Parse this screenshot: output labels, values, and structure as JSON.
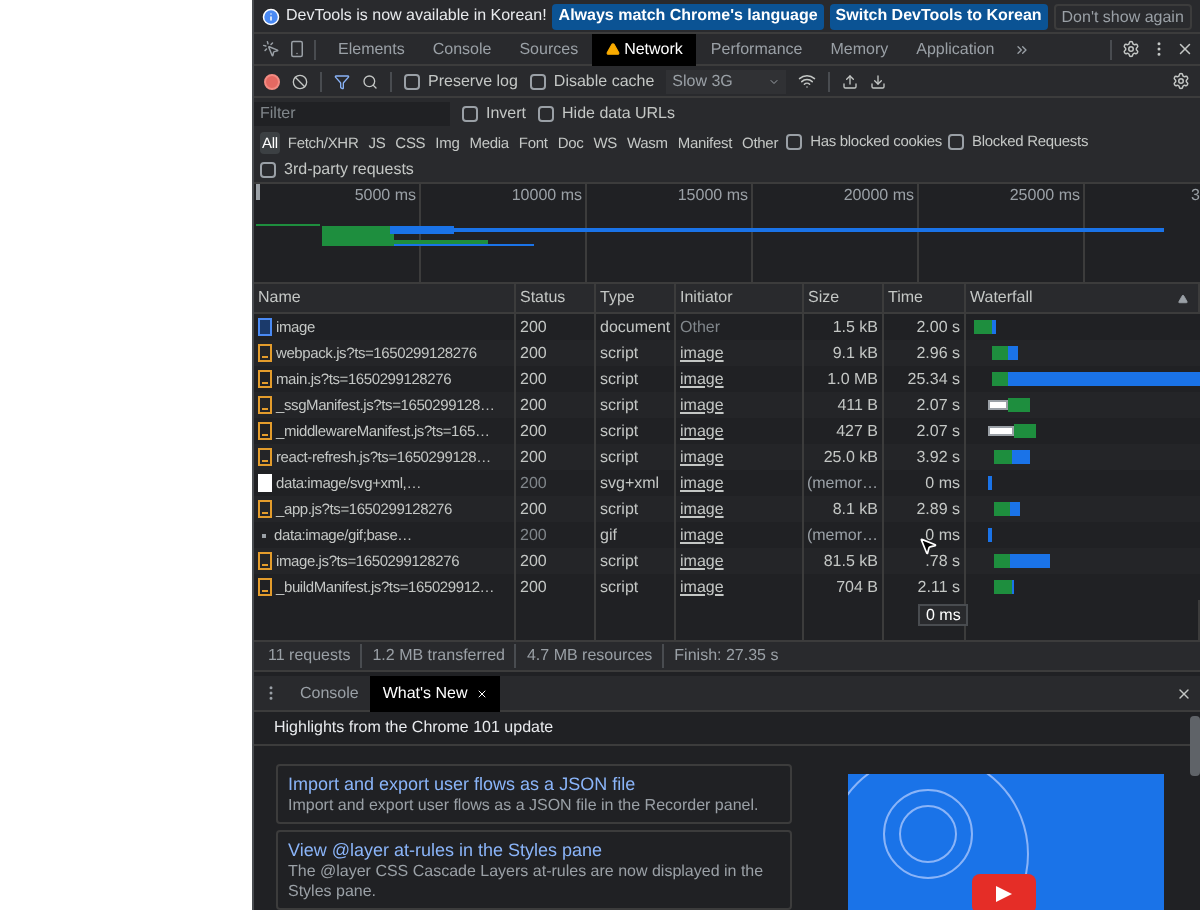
{
  "infobar": {
    "message": "DevTools is now available in Korean!",
    "buttons": [
      {
        "label": "Always match Chrome's language",
        "kind": "primary"
      },
      {
        "label": "Switch DevTools to Korean",
        "kind": "primary"
      },
      {
        "label": "Don't show again",
        "kind": "plain"
      }
    ]
  },
  "tabs": [
    {
      "label": "Elements",
      "selected": false,
      "warning": false
    },
    {
      "label": "Console",
      "selected": false,
      "warning": false
    },
    {
      "label": "Sources",
      "selected": false,
      "warning": false
    },
    {
      "label": "Network",
      "selected": true,
      "warning": true
    },
    {
      "label": "Performance",
      "selected": false,
      "warning": false
    },
    {
      "label": "Memory",
      "selected": false,
      "warning": false
    },
    {
      "label": "Application",
      "selected": false,
      "warning": false
    }
  ],
  "toolbar": {
    "options": [
      {
        "label": "Preserve log",
        "checked": false
      },
      {
        "label": "Disable cache",
        "checked": false
      }
    ],
    "throttling": "Slow 3G"
  },
  "filter": {
    "placeholder": "Filter",
    "options": [
      {
        "label": "Invert",
        "checked": false
      },
      {
        "label": "Hide data URLs",
        "checked": false
      }
    ]
  },
  "type_filters": [
    {
      "label": "All",
      "selected": true
    },
    {
      "label": "Fetch/XHR",
      "selected": false
    },
    {
      "label": "JS",
      "selected": false
    },
    {
      "label": "CSS",
      "selected": false
    },
    {
      "label": "Img",
      "selected": false
    },
    {
      "label": "Media",
      "selected": false
    },
    {
      "label": "Font",
      "selected": false
    },
    {
      "label": "Doc",
      "selected": false
    },
    {
      "label": "WS",
      "selected": false
    },
    {
      "label": "Wasm",
      "selected": false
    },
    {
      "label": "Manifest",
      "selected": false
    },
    {
      "label": "Other",
      "selected": false
    }
  ],
  "type_options": [
    {
      "label": "Has blocked cookies",
      "checked": false
    },
    {
      "label": "Blocked Requests",
      "checked": false
    }
  ],
  "third_party": {
    "label": "3rd-party requests",
    "checked": false
  },
  "overview": {
    "ticks": [
      "5000 ms",
      "10000 ms",
      "15000 ms",
      "20000 ms",
      "25000 ms",
      "3"
    ]
  },
  "table": {
    "columns": [
      {
        "label": "Name",
        "sorted": false
      },
      {
        "label": "Status",
        "sorted": false
      },
      {
        "label": "Type",
        "sorted": false
      },
      {
        "label": "Initiator",
        "sorted": false
      },
      {
        "label": "Size",
        "sorted": false
      },
      {
        "label": "Time",
        "sorted": false
      },
      {
        "label": "Waterfall",
        "sorted": true
      }
    ],
    "rows": [
      {
        "name": "image",
        "kind": "document",
        "status": "200",
        "cached": false,
        "type": "document",
        "initiator": "Other",
        "initiator_link": false,
        "size": "1.5 kB",
        "time": "2.00 s"
      },
      {
        "name": "webpack.js?ts=1650299128276",
        "kind": "script",
        "status": "200",
        "cached": false,
        "type": "script",
        "initiator": "image",
        "initiator_link": true,
        "size": "9.1 kB",
        "time": "2.96 s"
      },
      {
        "name": "main.js?ts=1650299128276",
        "kind": "script",
        "status": "200",
        "cached": false,
        "type": "script",
        "initiator": "image",
        "initiator_link": true,
        "size": "1.0 MB",
        "time": "25.34 s"
      },
      {
        "name": "_ssgManifest.js?ts=1650299128…",
        "kind": "script",
        "status": "200",
        "cached": false,
        "type": "script",
        "initiator": "image",
        "initiator_link": true,
        "size": "411 B",
        "time": "2.07 s"
      },
      {
        "name": "_middlewareManifest.js?ts=165…",
        "kind": "script",
        "status": "200",
        "cached": false,
        "type": "script",
        "initiator": "image",
        "initiator_link": true,
        "size": "427 B",
        "time": "2.07 s"
      },
      {
        "name": "react-refresh.js?ts=1650299128…",
        "kind": "script",
        "status": "200",
        "cached": false,
        "type": "script",
        "initiator": "image",
        "initiator_link": true,
        "size": "25.0 kB",
        "time": "3.92 s"
      },
      {
        "name": "data:image/svg+xml,…",
        "kind": "svg",
        "status": "200",
        "cached": true,
        "type": "svg+xml",
        "initiator": "image",
        "initiator_link": true,
        "size": "(memor…",
        "time": "0 ms"
      },
      {
        "name": "_app.js?ts=1650299128276",
        "kind": "script",
        "status": "200",
        "cached": false,
        "type": "script",
        "initiator": "image",
        "initiator_link": true,
        "size": "8.1 kB",
        "time": "2.89 s"
      },
      {
        "name": "data:image/gif;base…",
        "kind": "gif",
        "status": "200",
        "cached": true,
        "type": "gif",
        "initiator": "image",
        "initiator_link": true,
        "size": "(memor…",
        "time": "0 ms"
      },
      {
        "name": "image.js?ts=1650299128276",
        "kind": "script",
        "status": "200",
        "cached": false,
        "type": "script",
        "initiator": "image",
        "initiator_link": true,
        "size": "81.5 kB",
        "time": ".78 s"
      },
      {
        "name": "_buildManifest.js?ts=165029912…",
        "kind": "script",
        "status": "200",
        "cached": false,
        "type": "script",
        "initiator": "image",
        "initiator_link": true,
        "size": "704 B",
        "time": "2.11 s"
      }
    ]
  },
  "tooltip": "0 ms",
  "status_bar": [
    "11 requests",
    "1.2 MB transferred",
    "4.7 MB resources",
    "Finish: 27.35 s"
  ],
  "drawer": {
    "tabs": [
      {
        "label": "Console",
        "selected": false,
        "closable": false
      },
      {
        "label": "What's New",
        "selected": true,
        "closable": true
      }
    ],
    "heading": "Highlights from the Chrome 101 update",
    "cards": [
      {
        "title": "Import and export user flows as a JSON file",
        "description": "Import and export user flows as a JSON file in the Recorder panel."
      },
      {
        "title": "View @layer at-rules in the Styles pane",
        "description": "The @layer CSS Cascade Layers at-rules are now displayed in the Styles pane."
      }
    ]
  }
}
